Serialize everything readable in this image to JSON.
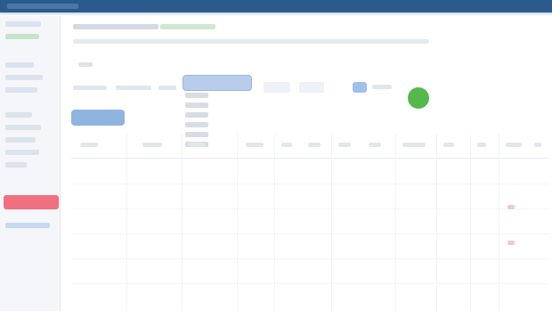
{
  "topbar": {
    "brand": ""
  },
  "sidebar": {
    "items": [
      "",
      "",
      "",
      "",
      "",
      "",
      "",
      "",
      "",
      ""
    ],
    "alert": "",
    "link": ""
  },
  "header": {
    "title": "",
    "status": "",
    "subtitle": ""
  },
  "filters": {
    "label": "",
    "dropdown": "",
    "dropdown_options": [
      "",
      "",
      "",
      "",
      "",
      ""
    ],
    "toggle": ""
  },
  "buttons": {
    "primary": "",
    "go": ""
  },
  "table": {
    "headers": [
      "",
      "",
      "",
      "",
      "",
      "",
      "",
      "",
      "",
      "",
      "",
      "",
      ""
    ]
  }
}
